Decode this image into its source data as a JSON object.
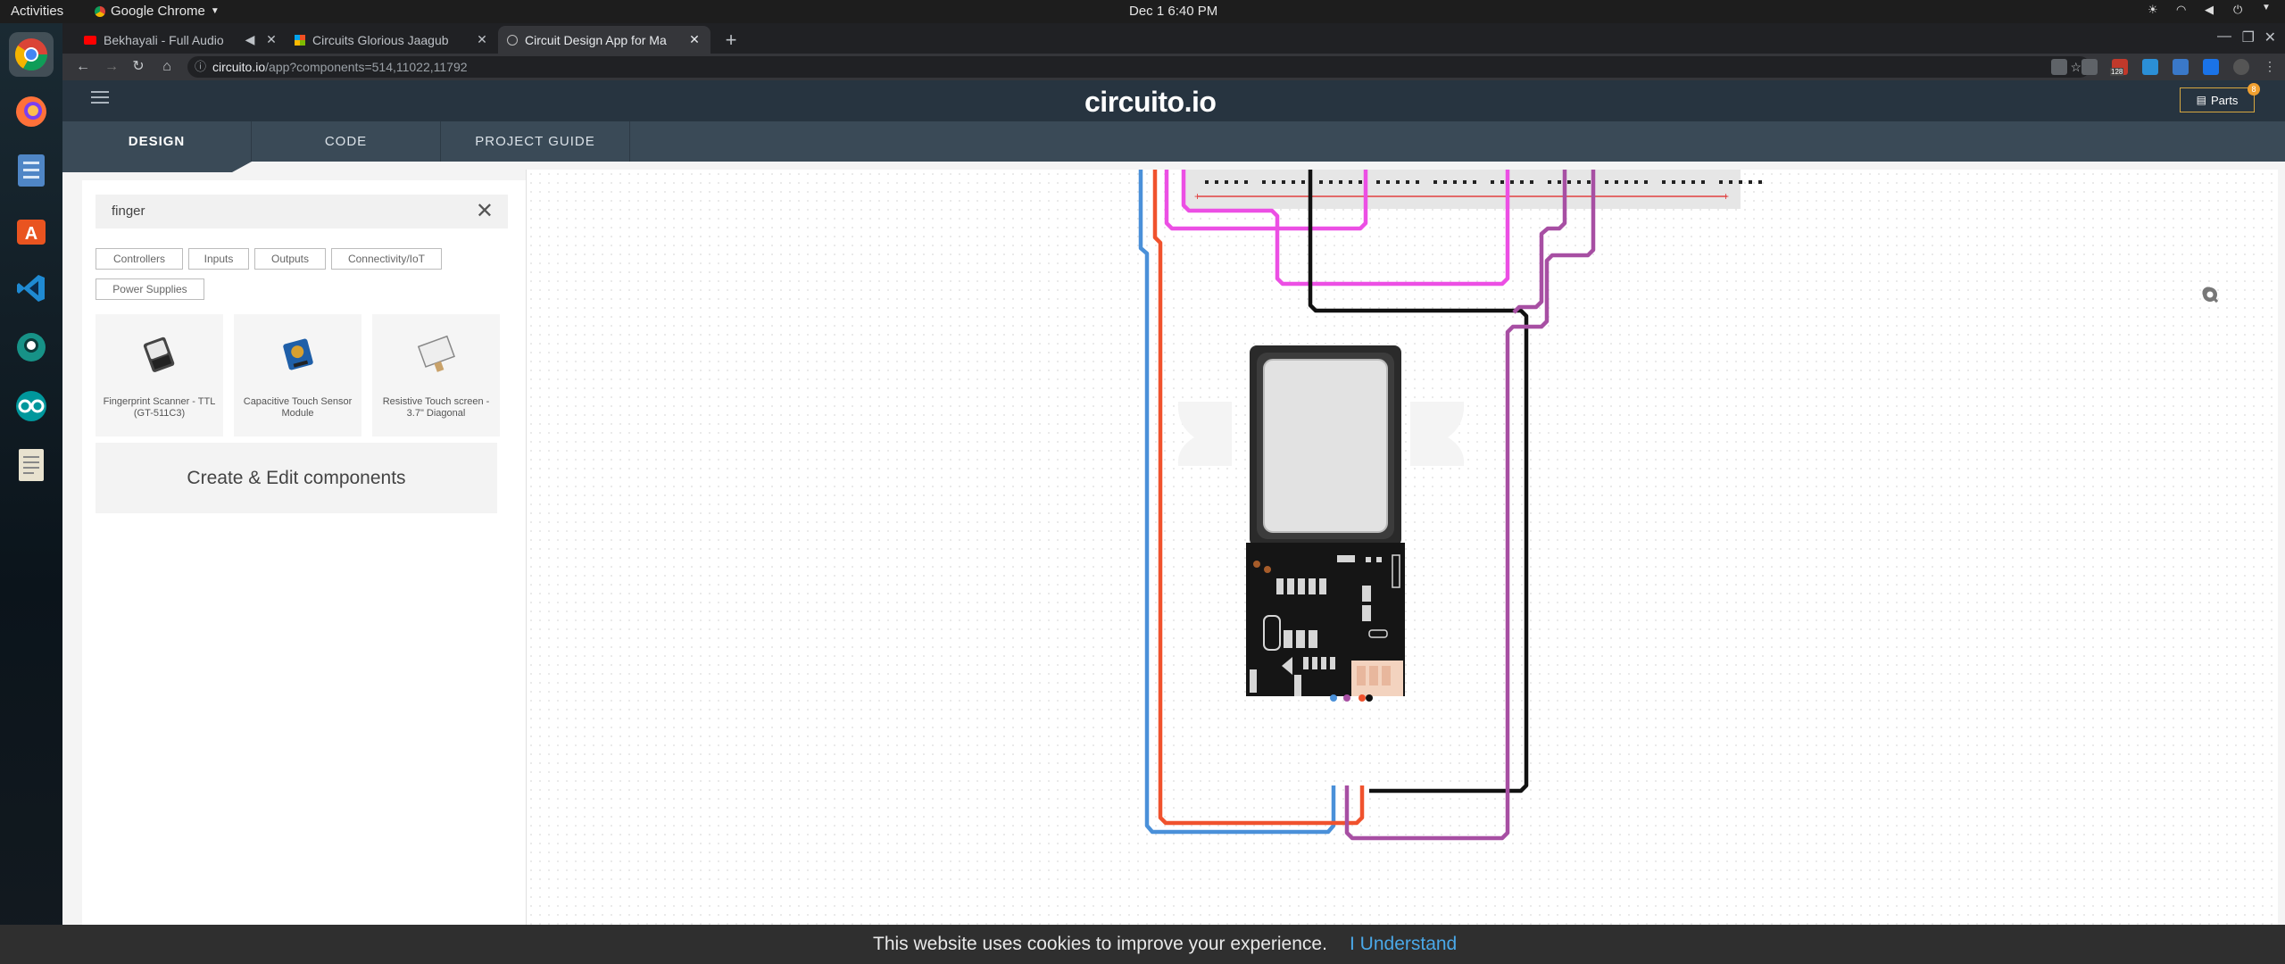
{
  "system": {
    "activities": "Activities",
    "app_menu": "Google Chrome",
    "clock": "Dec 1  6:40 PM"
  },
  "browser": {
    "tabs": [
      {
        "label": "Bekhayali - Full Audio",
        "active": false
      },
      {
        "label": "Circuits Glorious Jaagub",
        "active": false
      },
      {
        "label": "Circuit Design App for Ma",
        "active": true
      }
    ],
    "url_host": "circuito.io",
    "url_path": "/app?components=514,11022,11792",
    "extension_badge": "128"
  },
  "app": {
    "logo": "circuito.io",
    "parts_label": "Parts",
    "parts_count": "8",
    "tabs": [
      "DESIGN",
      "CODE",
      "PROJECT GUIDE"
    ],
    "active_tab": "DESIGN"
  },
  "sidebar": {
    "search_value": "finger",
    "filters": [
      "Controllers",
      "Inputs",
      "Outputs",
      "Connectivity/IoT",
      "Power Supplies"
    ],
    "results": [
      {
        "title": "Fingerprint Scanner - TTL (GT-511C3)",
        "icon": "fingerprint-scanner-icon"
      },
      {
        "title": "Capacitive Touch Sensor Module",
        "icon": "touch-sensor-icon"
      },
      {
        "title": "Resistive Touch screen - 3.7\" Diagonal",
        "icon": "touch-screen-icon"
      }
    ],
    "create_label": "Create & Edit components"
  },
  "cookie": {
    "text": "This website uses cookies to improve your experience.",
    "button": "I Understand"
  },
  "colors": {
    "header_bg": "#273440",
    "tabs_bg": "#3a4a57",
    "accent": "#4aa8e8",
    "wire_blue": "#4a90d9",
    "wire_red": "#f0522d",
    "wire_pink": "#ec4fe4",
    "wire_black": "#111111",
    "wire_purple": "#a74fa3"
  }
}
